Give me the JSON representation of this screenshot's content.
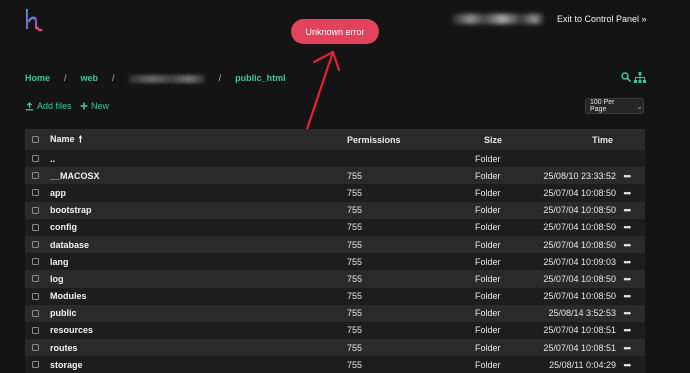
{
  "topbar": {
    "exit_link": "Exit to Control Panel »",
    "error_toast": "Unknown error"
  },
  "breadcrumb": {
    "home": "Home",
    "sep": "/",
    "web": "web",
    "folder": "public_html"
  },
  "toolbar": {
    "add_files": "Add files",
    "new": "New",
    "per_page": "100 Per Page"
  },
  "table": {
    "headers": {
      "name": "Name",
      "permissions": "Permissions",
      "size": "Size",
      "time": "Time"
    },
    "parent": {
      "name": "..",
      "size": "Folder"
    },
    "rows": [
      {
        "name": "__MACOSX",
        "permissions": "755",
        "size": "Folder",
        "time": "25/08/10 23:33:52",
        "actions": "•••"
      },
      {
        "name": "app",
        "permissions": "755",
        "size": "Folder",
        "time": "25/07/04 10:08:50",
        "actions": "•••"
      },
      {
        "name": "bootstrap",
        "permissions": "755",
        "size": "Folder",
        "time": "25/07/04 10:08:50",
        "actions": "•••"
      },
      {
        "name": "config",
        "permissions": "755",
        "size": "Folder",
        "time": "25/07/04 10:08:50",
        "actions": "•••"
      },
      {
        "name": "database",
        "permissions": "755",
        "size": "Folder",
        "time": "25/07/04 10:08:50",
        "actions": "•••"
      },
      {
        "name": "lang",
        "permissions": "755",
        "size": "Folder",
        "time": "25/07/04 10:09:03",
        "actions": "•••"
      },
      {
        "name": "log",
        "permissions": "755",
        "size": "Folder",
        "time": "25/07/04 10:08:50",
        "actions": "•••"
      },
      {
        "name": "Modules",
        "permissions": "755",
        "size": "Folder",
        "time": "25/07/04 10:08:50",
        "actions": "•••"
      },
      {
        "name": "public",
        "permissions": "755",
        "size": "Folder",
        "time": "25/08/14 3:52:53",
        "actions": "•••"
      },
      {
        "name": "resources",
        "permissions": "755",
        "size": "Folder",
        "time": "25/07/04 10:08:51",
        "actions": "•••"
      },
      {
        "name": "routes",
        "permissions": "755",
        "size": "Folder",
        "time": "25/07/04 10:08:51",
        "actions": "•••"
      },
      {
        "name": "storage",
        "permissions": "755",
        "size": "Folder",
        "time": "25/08/11 0:04:29",
        "actions": "•••"
      }
    ]
  },
  "colors": {
    "accent": "#3cc6a0",
    "error": "#e0435b",
    "annotation": "#e0233a"
  },
  "icons": [
    "logo-icon",
    "search-icon",
    "sitemap-icon",
    "upload-icon",
    "plus-icon",
    "chevron-down-icon",
    "sort-arrow-up-icon",
    "more-icon",
    "checkbox-icon"
  ]
}
